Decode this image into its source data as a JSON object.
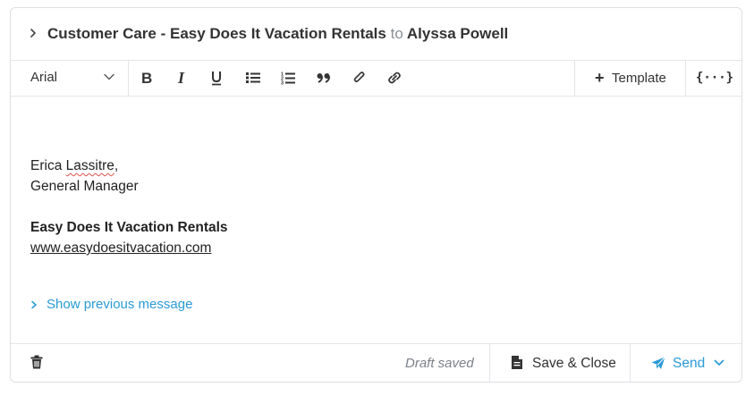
{
  "header": {
    "subject": "Customer Care - Easy Does It Vacation Rentals",
    "to_word": "to",
    "recipient": "Alyssa Powell"
  },
  "toolbar": {
    "font": "Arial",
    "buttons": [
      {
        "name": "bold",
        "icon": "bold-icon",
        "glyph": "B"
      },
      {
        "name": "italic",
        "icon": "italic-icon",
        "glyph": "I"
      },
      {
        "name": "underline",
        "icon": "underline-icon",
        "glyph": "U"
      },
      {
        "name": "bulleted-list",
        "icon": "bulleted-list-icon"
      },
      {
        "name": "numbered-list",
        "icon": "numbered-list-icon"
      },
      {
        "name": "quote",
        "icon": "quote-icon",
        "glyph": "❞"
      },
      {
        "name": "attachment",
        "icon": "paperclip-icon"
      },
      {
        "name": "link",
        "icon": "link-icon"
      }
    ],
    "template_label": "Template",
    "variables_label": "{···}"
  },
  "editor": {
    "signature_first": "Erica",
    "signature_last": "Lassitre",
    "signature_comma": ",",
    "signature_title": "General Manager",
    "company": "Easy Does It Vacation Rentals",
    "website": "www.easydoesitvacation.com",
    "show_previous": "Show previous message"
  },
  "footer": {
    "draft_status": "Draft saved",
    "save_close_label": "Save & Close",
    "send_label": "Send"
  },
  "colors": {
    "accent": "#2a9ad6",
    "border": "#dcdfe3",
    "spellcheck": "#e0524b"
  }
}
